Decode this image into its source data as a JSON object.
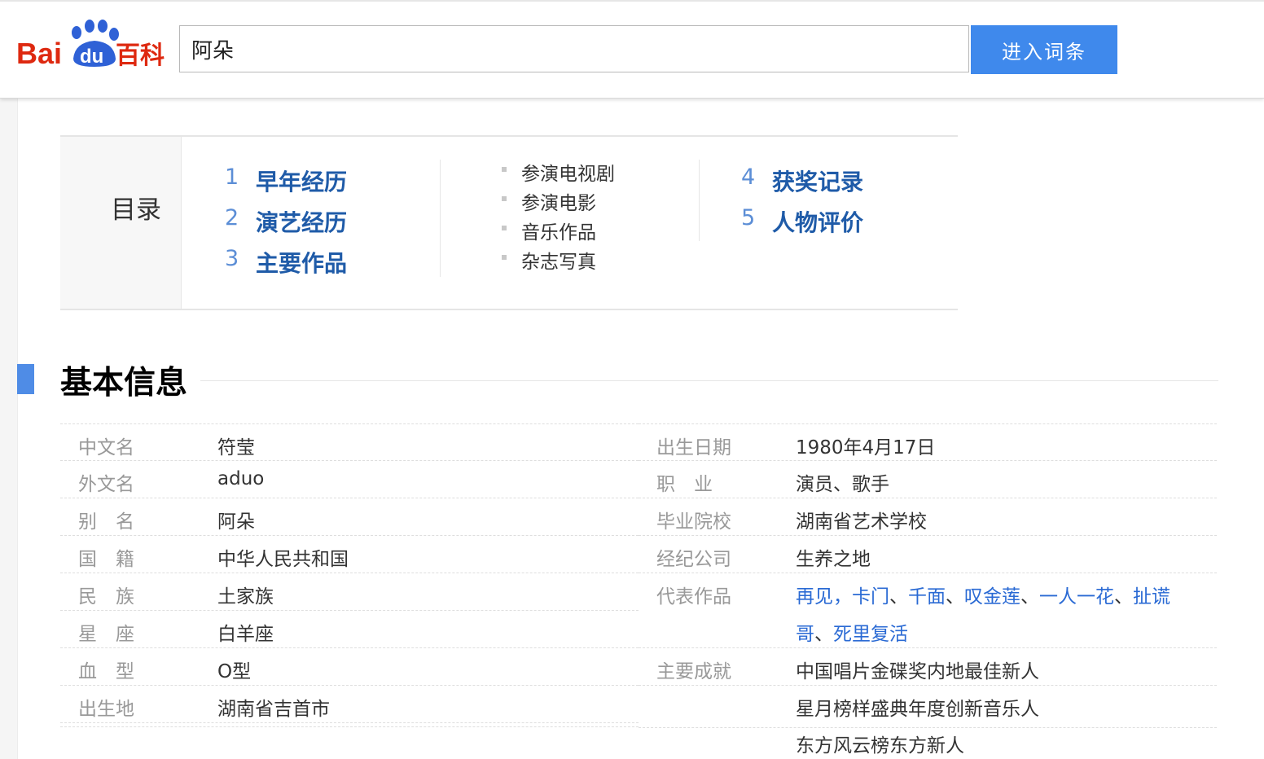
{
  "header": {
    "logo_text_1": "Bai",
    "logo_text_2": "du",
    "logo_text_3": "百科",
    "search_value": "阿朵",
    "search_button": "进入词条"
  },
  "toc": {
    "label": "目录",
    "items": [
      {
        "num": "1",
        "text": "早年经历"
      },
      {
        "num": "2",
        "text": "演艺经历"
      },
      {
        "num": "3",
        "text": "主要作品"
      },
      {
        "num": "4",
        "text": "获奖记录"
      },
      {
        "num": "5",
        "text": "人物评价"
      }
    ],
    "subitems": [
      "参演电视剧",
      "参演电影",
      "音乐作品",
      "杂志写真"
    ]
  },
  "section": {
    "title": "基本信息"
  },
  "info_left": [
    {
      "label": "中文名",
      "value": "符莹"
    },
    {
      "label": "外文名",
      "value": "aduo"
    },
    {
      "label": "别　名",
      "value": "阿朵"
    },
    {
      "label": "国　籍",
      "value": "中华人民共和国"
    },
    {
      "label": "民　族",
      "value": "土家族"
    },
    {
      "label": "星　座",
      "value": "白羊座"
    },
    {
      "label": "血　型",
      "value": "O型"
    },
    {
      "label": "出生地",
      "value": "湖南省吉首市"
    }
  ],
  "info_right": {
    "birth": {
      "label": "出生日期",
      "value": "1980年4月17日"
    },
    "job": {
      "label": "职　业",
      "value": "演员、歌手"
    },
    "school": {
      "label": "毕业院校",
      "value": "湖南省艺术学校"
    },
    "agency": {
      "label": "经纪公司",
      "value": "生养之地"
    },
    "works": {
      "label": "代表作品",
      "links": [
        "再见",
        "卡门",
        "千面",
        "叹金莲",
        "一人一花",
        "扯谎哥",
        "死里复活"
      ],
      "sep_comma": "，",
      "sep_dun": "、",
      "wrap_a": "扯谎",
      "wrap_b": "哥"
    },
    "achievements": {
      "label": "主要成就",
      "values": [
        "中国唱片金碟奖内地最佳新人",
        "星月榜样盛典年度创新音乐人",
        "东方风云榜东方新人"
      ]
    }
  },
  "colors": {
    "accent_blue": "#3f89ec",
    "link_blue": "#2a6ad4",
    "toc_blue": "#1f5ba8",
    "logo_red": "#de2910",
    "logo_blue": "#2f61d6"
  }
}
